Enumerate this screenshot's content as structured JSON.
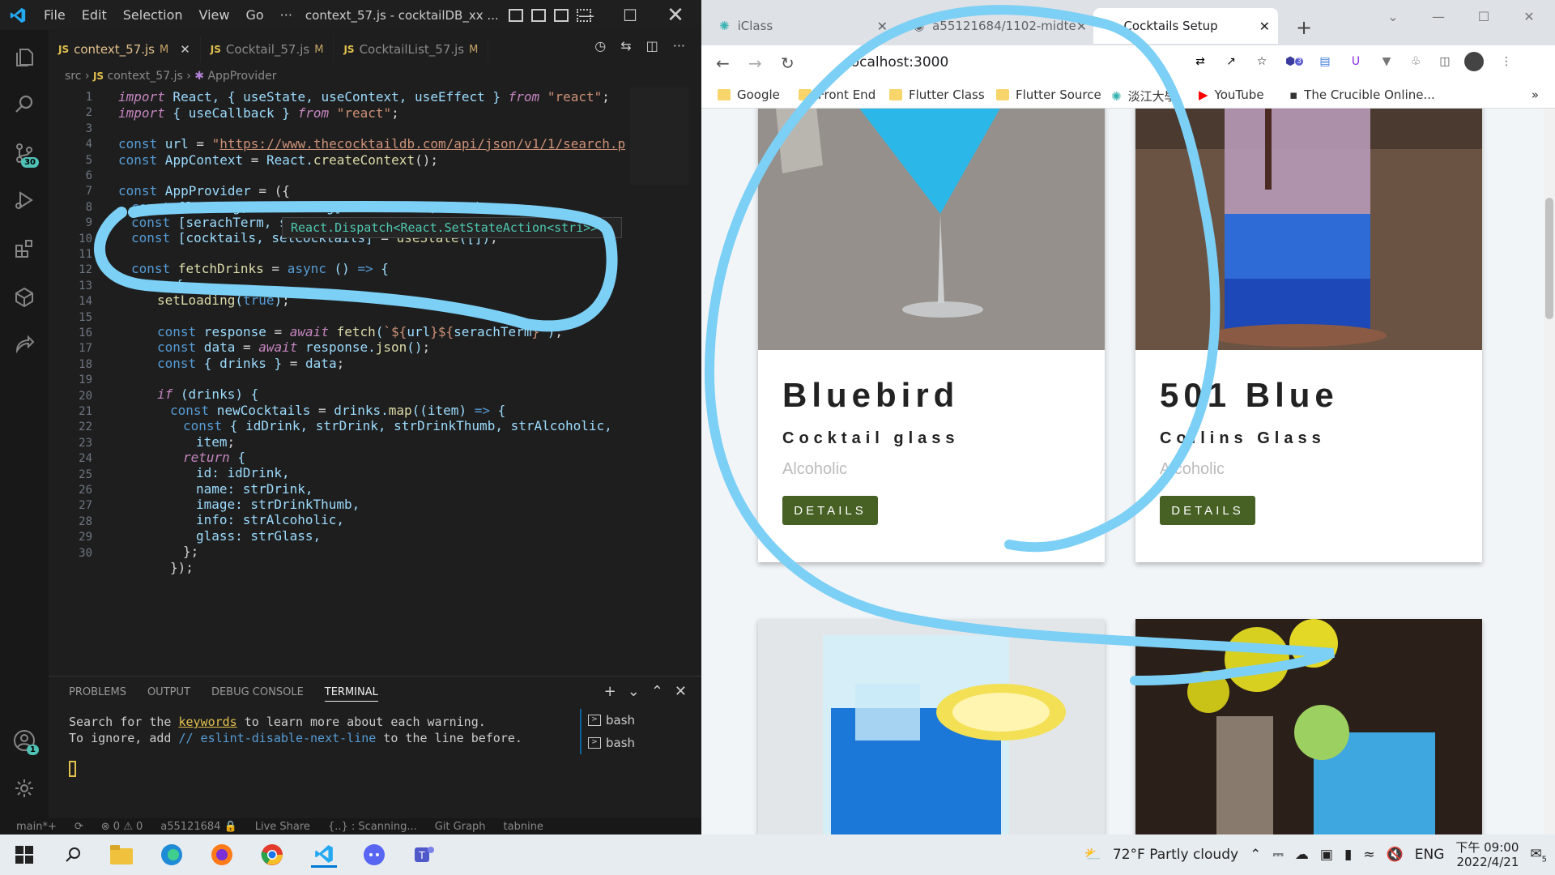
{
  "vscode": {
    "menu": [
      "File",
      "Edit",
      "Selection",
      "View",
      "Go",
      "···"
    ],
    "window_title": "context_57.js - cocktailDB_xx ...",
    "tabs": [
      {
        "name": "context_57.js",
        "status": "M",
        "active": true
      },
      {
        "name": "Cocktail_57.js",
        "status": "M",
        "active": false
      },
      {
        "name": "CocktailList_57.js",
        "status": "M",
        "active": false
      }
    ],
    "breadcrumb": {
      "folder": "src",
      "file": "context_57.js",
      "symbol": "AppProvider"
    },
    "activity_badges": {
      "source_control": "30",
      "accounts": "1"
    },
    "tooltip": "React.Dispatch<React.SetStateAction<stri",
    "tooltip_tail": ">>",
    "line_numbers": [
      "1",
      "2",
      "3",
      "4",
      "5",
      "6",
      "7",
      "8",
      "9",
      "10",
      "11",
      "12",
      "13",
      "14",
      "15",
      "16",
      "17",
      "18",
      "19",
      "20",
      "21",
      "22",
      "23",
      "24",
      "25",
      "26",
      "27",
      "28",
      "29",
      "30"
    ],
    "panel": {
      "tabs": [
        "PROBLEMS",
        "OUTPUT",
        "DEBUG CONSOLE",
        "TERMINAL"
      ],
      "active_tab": "TERMINAL",
      "terminal_line1_pre": "Search for the ",
      "terminal_link": "keywords",
      "terminal_line1_post": " to learn more about each warning.",
      "terminal_line2_pre": "To ignore, add ",
      "terminal_comment": "// eslint-disable-next-line",
      "terminal_line2_post": " to the line before.",
      "shells": [
        "bash",
        "bash"
      ]
    },
    "statusbar": [
      "main*+",
      "⊗ 0 ⚠ 0",
      "a55121684 🔒",
      "Live Share",
      "{..} : Scanning...",
      "Git Graph",
      "tabnine"
    ]
  },
  "chrome": {
    "tabs": [
      {
        "title": "iClass",
        "active": false
      },
      {
        "title": "a55121684/1102-midte",
        "active": false
      },
      {
        "title": "Cocktails Setup",
        "active": true
      }
    ],
    "url": "localhost:3000",
    "bookmarks": [
      "Google",
      "Front End",
      "Flutter Class",
      "Flutter Source",
      "淡江大學",
      "YouTube",
      "The Crucible Online..."
    ],
    "extension_badge": "3",
    "cards": [
      {
        "name": "Bluebird",
        "glass": "Cocktail glass",
        "info": "Alcoholic",
        "button": "DETAILS"
      },
      {
        "name": "501 Blue",
        "glass": "Collins Glass",
        "info": "Alcoholic",
        "button": "DETAILS"
      }
    ]
  },
  "taskbar": {
    "weather": "72°F  Partly cloudy",
    "lang": "ENG",
    "time": "下午 09:00",
    "date": "2022/4/21",
    "notif": "5"
  },
  "colors": {
    "accent": "#476125",
    "annotation": "#7ccff5"
  }
}
